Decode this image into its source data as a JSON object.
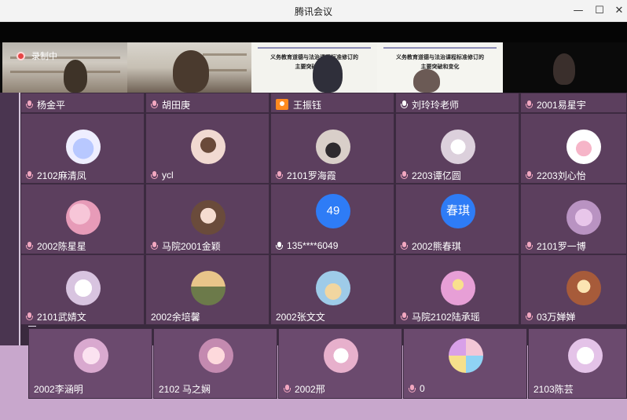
{
  "window": {
    "title": "腾讯会议",
    "min": "—",
    "max": "☐",
    "close": "✕"
  },
  "recording": {
    "label": "录制中"
  },
  "slides": [
    {
      "line1": "义务教育道德与法治课程标准修订的",
      "line2": "主要突破和变化"
    },
    {
      "line1": "义务教育道德与法治课程标准修订的",
      "line2": "主要突破和变化"
    }
  ],
  "top_names": [
    "杨金平",
    "胡田庚",
    "王振钰",
    "刘玲玲老师",
    "2001易星宇"
  ],
  "rows": [
    [
      "2102麻清凤",
      "ycl",
      "2101罗海霞",
      "2203谭亿圆",
      "2203刘心怡"
    ],
    [
      "2002陈星星",
      "马院2001金颖",
      "135****6049",
      "2002熊春琪",
      "2101罗一博"
    ],
    [
      "2101武婧文",
      "2002余培馨",
      "2002张文文",
      "马院2102陆承瑶",
      "03万婵婵"
    ],
    [
      "2002李涵明",
      "2102 马之娴",
      "2002邢",
      "0",
      "2103陈芸"
    ]
  ],
  "number_avatars": {
    "r1c2": "49",
    "r1c3": "春琪"
  },
  "colors": {
    "tile_bg": "#5c3f5e",
    "number_avatar": "#2e7cf6",
    "host_badge": "#ff8a1f",
    "record_dot": "#e64545"
  }
}
